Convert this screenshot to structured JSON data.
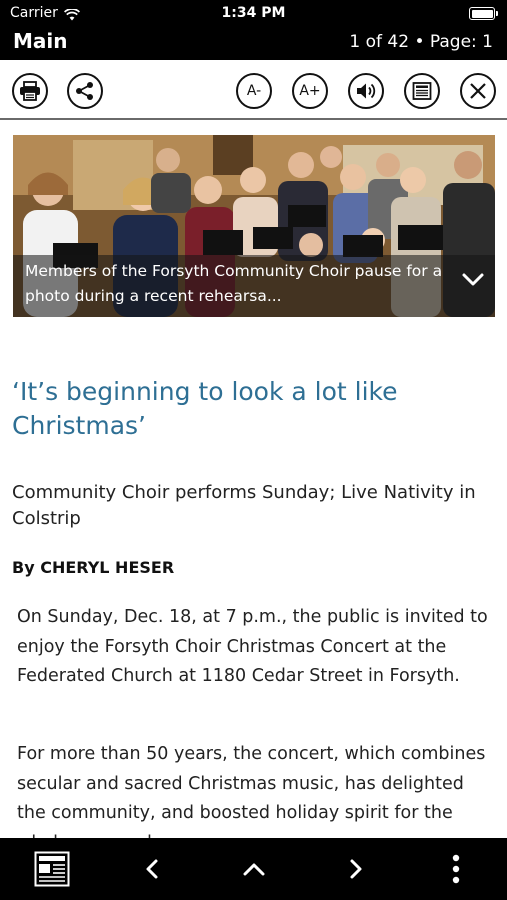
{
  "status_bar": {
    "carrier": "Carrier",
    "time": "1:34 PM"
  },
  "header": {
    "title": "Main",
    "page_info": "1 of 42 • Page: 1"
  },
  "toolbar": {
    "font_decrease_label": "A-",
    "font_increase_label": "A+"
  },
  "photo": {
    "caption": "Members of the Forsyth Community Choir pause for a photo during a recent rehearsa..."
  },
  "article": {
    "headline": "‘It’s beginning to look a lot like Christmas’",
    "subheadline": "Community Choir performs Sunday; Live Nativity in Colstrip",
    "byline": "By CHERYL HESER",
    "paragraphs": [
      "On Sunday, Dec. 18, at 7 p.m., the public is invited to enjoy the Forsyth Choir Christmas Concert at the Federated Church at 1180 Cedar Street in Forsyth.",
      "For more than 50 years, the concert, which combines secular and sacred Christmas music, has delighted the community, and boosted holiday spirit for the whole area and"
    ]
  },
  "colors": {
    "headline": "#2e6f94",
    "bars": "#000000"
  }
}
